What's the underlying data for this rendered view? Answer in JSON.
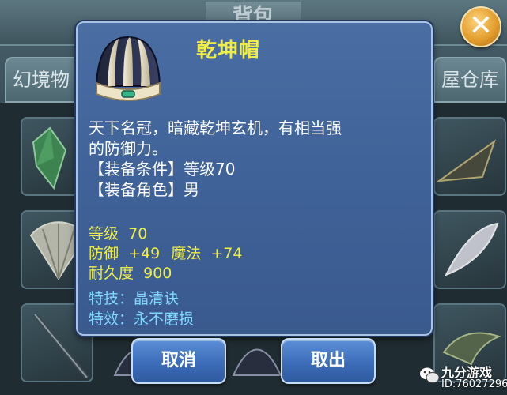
{
  "background": {
    "title": "背包",
    "tab_left": "幻境物",
    "tab_right": "屋仓库",
    "close_icon": "close-icon"
  },
  "tooltip": {
    "item_name": "乾坤帽",
    "item_icon": "helmet-icon",
    "description": {
      "line1": "天下名冠，暗藏乾坤玄机，有相当强",
      "line2": "的防御力。",
      "equip_condition_label": "【装备条件】",
      "equip_condition_value": "等级70",
      "equip_role_label": "【装备角色】",
      "equip_role_value": "男"
    },
    "stats": {
      "level_label": "等级",
      "level_value": "70",
      "defense_label": "防御",
      "defense_value": "+49",
      "magic_label": "魔法",
      "magic_value": "+74",
      "durability_label": "耐久度",
      "durability_value": "900"
    },
    "specials": {
      "skill_label": "特技：",
      "skill_value": "晶清诀",
      "effect_label": "特效：",
      "effect_value": "永不磨损"
    }
  },
  "buttons": {
    "cancel": "取消",
    "take_out": "取出"
  },
  "watermark": {
    "brand": "九分游戏",
    "id": "ID:76027296"
  },
  "colors": {
    "item_name": "#f0ee46",
    "stats": "#f0ee46",
    "specials": "#7fd8ff",
    "popup_bg": "#4466a0",
    "button_bg": "#3c6cb8"
  }
}
